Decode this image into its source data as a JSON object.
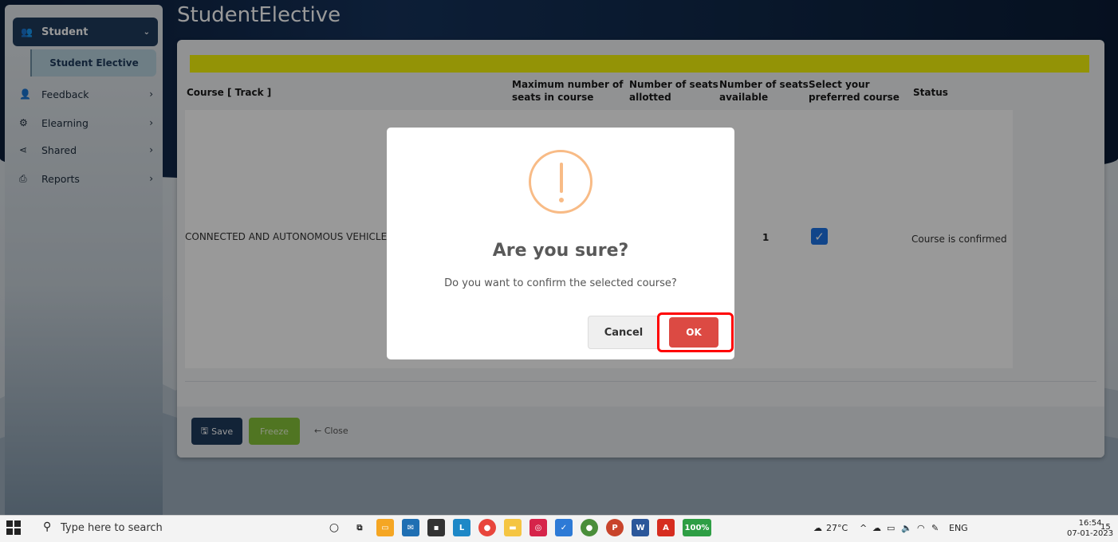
{
  "page": {
    "title": "StudentElective"
  },
  "sidebar": {
    "header": {
      "label": "Student",
      "icon": "users-icon"
    },
    "active_sub": "Student Elective",
    "items": [
      {
        "label": "Feedback",
        "icon": "user-icon"
      },
      {
        "label": "Elearning",
        "icon": "gears-icon"
      },
      {
        "label": "Shared",
        "icon": "share-icon"
      },
      {
        "label": "Reports",
        "icon": "printer-icon"
      }
    ]
  },
  "table": {
    "headers": [
      "Course [ Track ]",
      "Maximum number of seats in course",
      "Number of seats allotted",
      "Number of seats available",
      "Select your preferred course",
      "Status"
    ],
    "row": {
      "course": "CONNECTED AND AUTONOMOUS VEHICLES",
      "available": "1",
      "selected": true,
      "status": "Course is confirmed"
    }
  },
  "actions": {
    "save": "Save",
    "freeze": "Freeze",
    "close": "← Close"
  },
  "modal": {
    "title": "Are you sure?",
    "text": "Do you want to confirm the selected course?",
    "cancel": "Cancel",
    "ok": "OK",
    "icon": "warning-icon"
  },
  "taskbar": {
    "search_placeholder": "Type here to search",
    "battery": "100%",
    "weather": "27°C",
    "language": "ENG",
    "time": "16:54",
    "date": "07-01-2023",
    "notifications": "15"
  },
  "colors": {
    "accent": "#1f3b5c",
    "ok": "#dc4a43",
    "highlight": "#ff0000",
    "warning": "#f8bb86"
  }
}
